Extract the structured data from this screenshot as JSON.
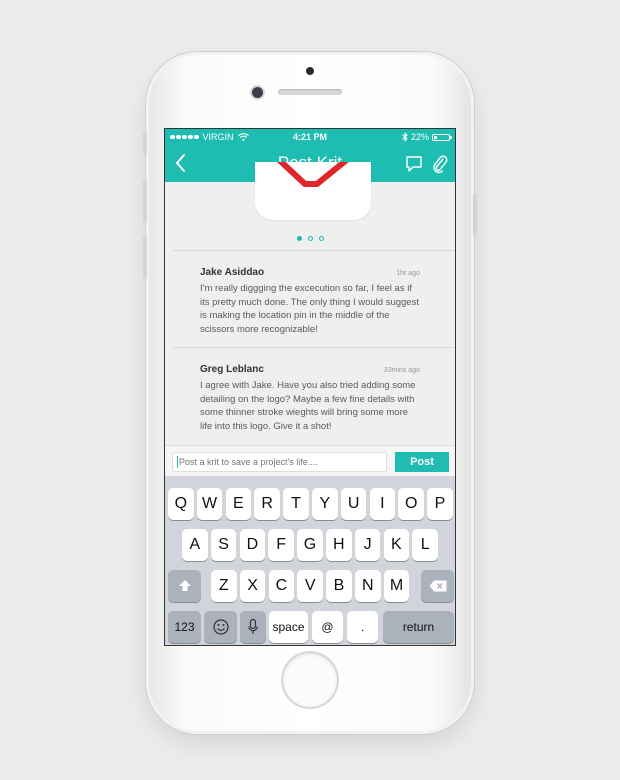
{
  "status_bar": {
    "carrier": "VIRGIN",
    "time": "4:21 PM",
    "battery_percent": "22%",
    "battery_level": 0.22
  },
  "nav": {
    "title": "Post Krit",
    "back_icon": "chevron-left-icon",
    "comment_icon": "speech-bubble-icon",
    "attach_icon": "paperclip-icon"
  },
  "pager": {
    "pages": 3,
    "active_index": 0
  },
  "comments": [
    {
      "author": "Jake Asiddao",
      "time": "1hr ago",
      "text": "I'm really diggging the excecution so far, I feel as if its pretty much done. The only thing I would suggest is making the location pin in the middle of the scissors more recognizable!"
    },
    {
      "author": "Greg Leblanc",
      "time": "33mins ago",
      "text": "I agree with Jake. Have you also tried adding some detailing on the logo? Maybe a few fine details with some thinner stroke wieghts will bring some more life into this logo. Give it a shot!"
    }
  ],
  "composer": {
    "placeholder": "Post a krit to save a project's life....",
    "post_label": "Post"
  },
  "keyboard": {
    "row1": [
      "Q",
      "W",
      "E",
      "R",
      "T",
      "Y",
      "U",
      "I",
      "O",
      "P"
    ],
    "row2": [
      "A",
      "S",
      "D",
      "F",
      "G",
      "H",
      "J",
      "K",
      "L"
    ],
    "row3": [
      "Z",
      "X",
      "C",
      "V",
      "B",
      "N",
      "M"
    ],
    "numbers_label": "123",
    "space_label": "space",
    "at_label": "@",
    "dot_label": ".",
    "return_label": "return"
  },
  "colors": {
    "accent": "#1ebcb1",
    "logo_red": "#e0262b"
  }
}
